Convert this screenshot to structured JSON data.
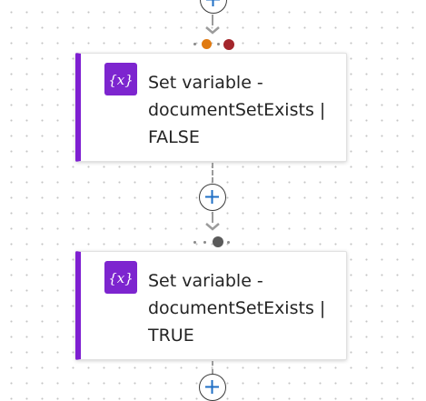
{
  "flow": {
    "steps": [
      {
        "type": "Set variable",
        "title": "Set variable - documentSetExists | FALSE",
        "variable_icon": "variable-icon",
        "accent_color": "#7e1fd1"
      },
      {
        "type": "Set variable",
        "title": "Set variable - documentSetExists | TRUE",
        "variable_icon": "variable-icon",
        "accent_color": "#7e1fd1"
      }
    ],
    "branch_dots": {
      "first": {
        "left_color": "#e07a10",
        "right_color": "#a4262c"
      },
      "second": {
        "center_color": "#5a5a5a"
      }
    },
    "icons": {
      "add": "plus-icon",
      "connector_arrow": "chevron-down-icon"
    }
  }
}
